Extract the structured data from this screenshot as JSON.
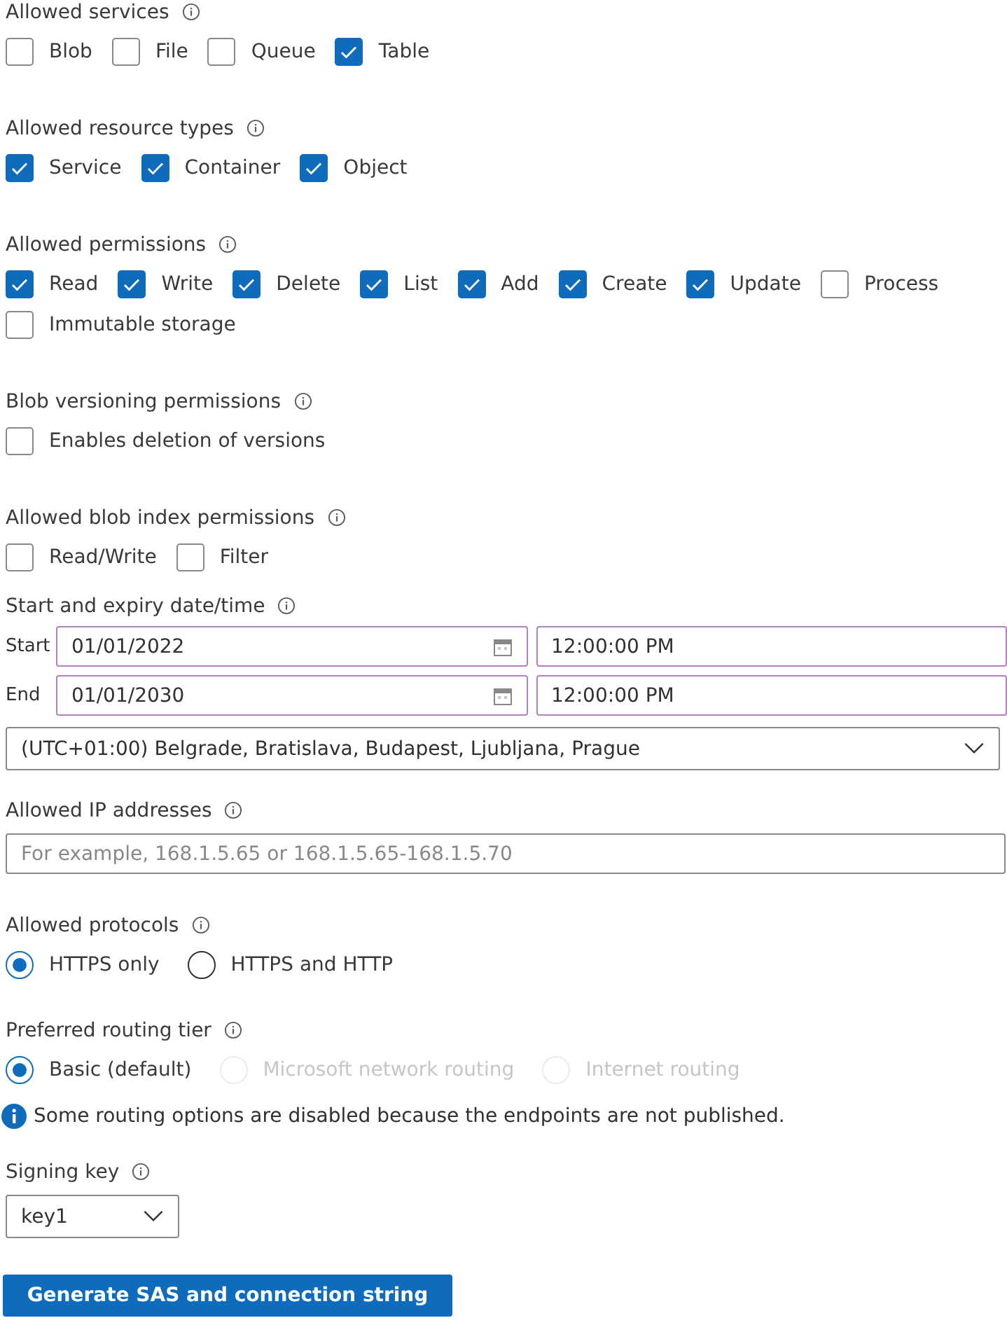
{
  "checkbox_groups": [
    {
      "label": "Allowed services",
      "options": [
        {
          "label": "Blob",
          "checked": false
        },
        {
          "label": "File",
          "checked": false
        },
        {
          "label": "Queue",
          "checked": false
        },
        {
          "label": "Table",
          "checked": true
        }
      ]
    },
    {
      "label": "Allowed resource types",
      "options": [
        {
          "label": "Service",
          "checked": true
        },
        {
          "label": "Container",
          "checked": true
        },
        {
          "label": "Object",
          "checked": true
        }
      ]
    },
    {
      "label": "Allowed permissions",
      "options": [
        {
          "label": "Read",
          "checked": true
        },
        {
          "label": "Write",
          "checked": true
        },
        {
          "label": "Delete",
          "checked": true
        },
        {
          "label": "List",
          "checked": true
        },
        {
          "label": "Add",
          "checked": true
        },
        {
          "label": "Create",
          "checked": true
        },
        {
          "label": "Update",
          "checked": true
        },
        {
          "label": "Process",
          "checked": false
        },
        {
          "label": "Immutable storage",
          "checked": false
        }
      ]
    },
    {
      "label": "Blob versioning permissions",
      "options": [
        {
          "label": "Enables deletion of versions",
          "checked": false
        }
      ]
    },
    {
      "label": "Allowed blob index permissions",
      "options": [
        {
          "label": "Read/Write",
          "checked": false
        },
        {
          "label": "Filter",
          "checked": false
        }
      ]
    }
  ],
  "datetime": {
    "label": "Start and expiry date/time",
    "rows": [
      {
        "label": "Start",
        "date": "01/01/2022",
        "time": "12:00:00 PM"
      },
      {
        "label": "End",
        "date": "01/01/2030",
        "time": "12:00:00 PM"
      }
    ],
    "timezone": "(UTC+01:00) Belgrade, Bratislava, Budapest, Ljubljana, Prague"
  },
  "ip": {
    "label": "Allowed IP addresses",
    "placeholder": "For example, 168.1.5.65 or 168.1.5.65-168.1.5.70"
  },
  "radio_groups": [
    {
      "label": "Allowed protocols",
      "options": [
        {
          "label": "HTTPS only",
          "selected": true,
          "disabled": false
        },
        {
          "label": "HTTPS and HTTP",
          "selected": false,
          "disabled": false
        }
      ]
    },
    {
      "label": "Preferred routing tier",
      "options": [
        {
          "label": "Basic (default)",
          "selected": true,
          "disabled": false
        },
        {
          "label": "Microsoft network routing",
          "selected": false,
          "disabled": true
        },
        {
          "label": "Internet routing",
          "selected": false,
          "disabled": true
        }
      ]
    }
  ],
  "info_message": "Some routing options are disabled because the endpoints are not published.",
  "signing_key": {
    "label": "Signing key",
    "value": "key1"
  },
  "button": "Generate SAS and connection string"
}
